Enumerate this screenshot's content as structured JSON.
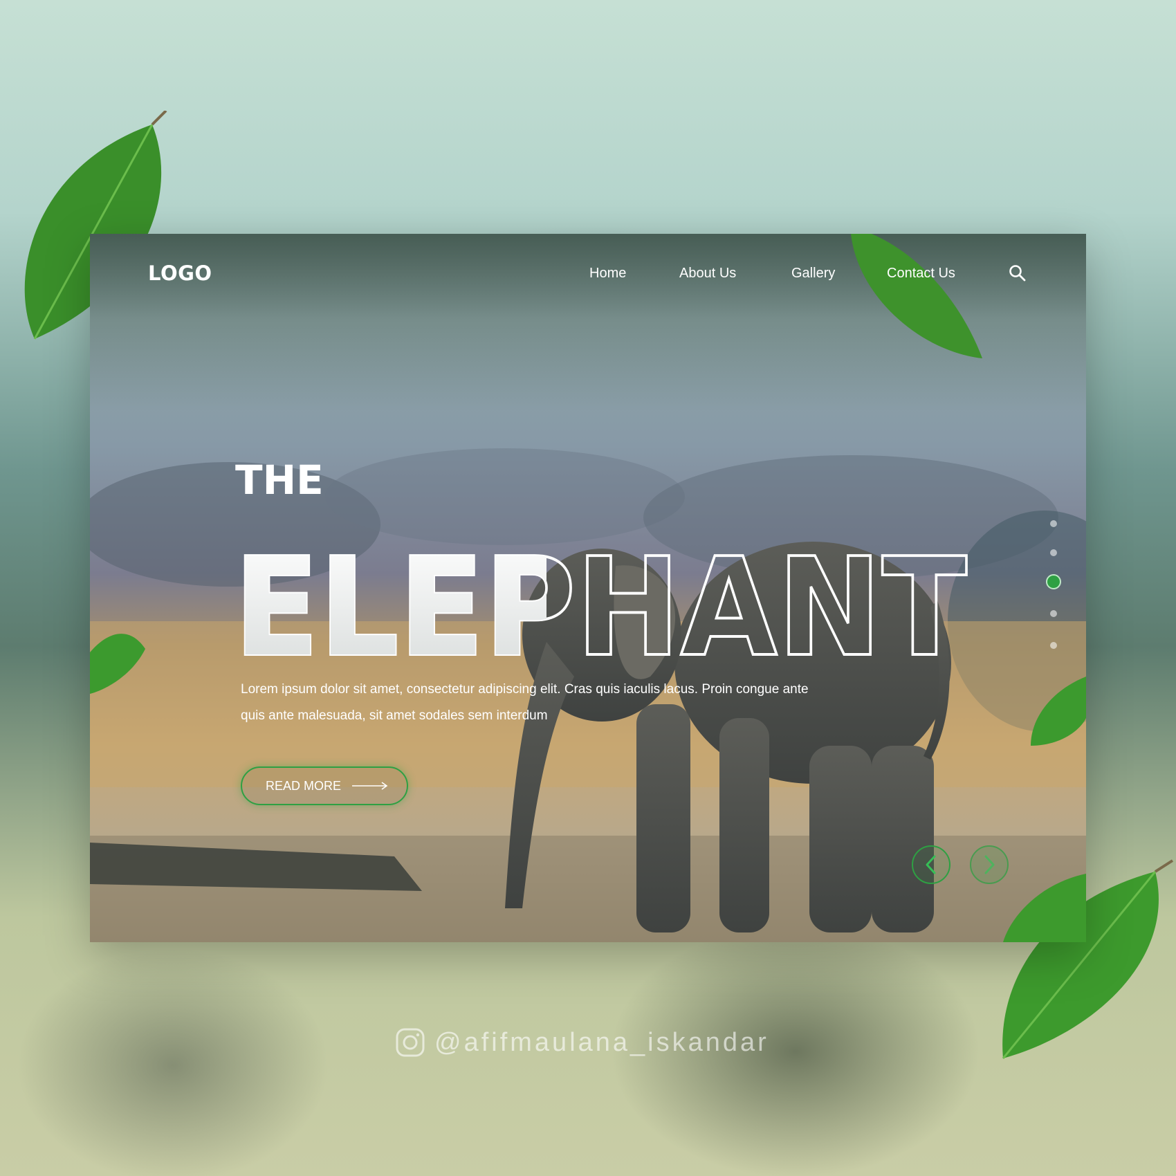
{
  "nav": {
    "logo": "LOGO",
    "items": [
      {
        "label": "Home"
      },
      {
        "label": "About Us"
      },
      {
        "label": "Gallery"
      },
      {
        "label": "Contact Us"
      }
    ],
    "search_icon": "search-icon"
  },
  "hero": {
    "kicker": "THE",
    "title": "ELEPHANT",
    "description": "Lorem ipsum dolor sit amet, consectetur adipiscing elit. Cras quis iaculis lacus. Proin congue ante quis ante malesuada, sit amet sodales sem interdum",
    "cta_label": "READ MORE",
    "cta_icon": "long-arrow-right-icon"
  },
  "pagination": {
    "total": 5,
    "active_index": 2
  },
  "carousel": {
    "prev_icon": "chevron-left-icon",
    "next_icon": "chevron-right-icon"
  },
  "watermark": {
    "icon": "instagram-icon",
    "handle": "@afifmaulana_iskandar"
  },
  "colors": {
    "accent": "#2ea043",
    "leaf": "#3f9a2f",
    "text": "#ffffff"
  }
}
